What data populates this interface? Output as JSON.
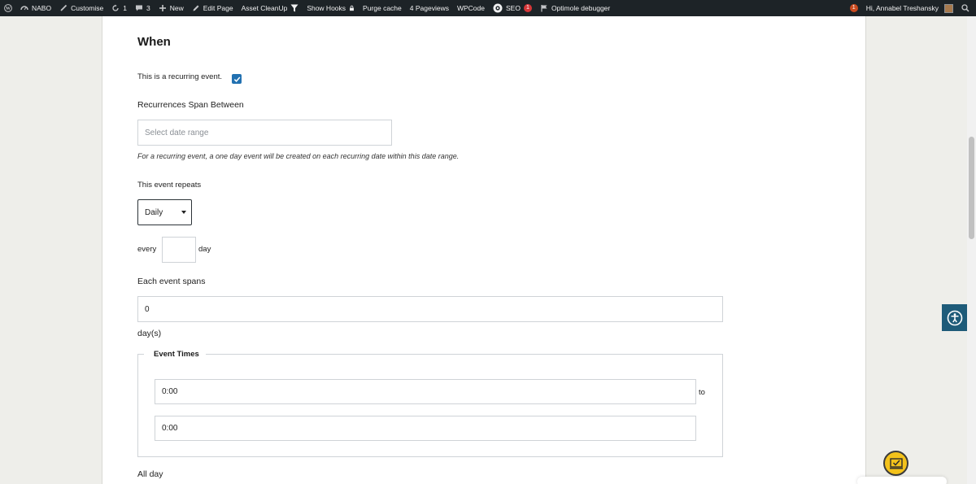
{
  "adminbar": {
    "site_name": "NABO",
    "customise": "Customise",
    "updates_count": "1",
    "comments_count": "3",
    "new": "New",
    "edit_page": "Edit Page",
    "asset_cleanup": "Asset CleanUp",
    "show_hooks": "Show Hooks",
    "purge_cache": "Purge cache",
    "pageviews": "4 Pageviews",
    "wpcode": "WPCode",
    "seo": "SEO",
    "seo_badge": "1",
    "optimole": "Optimole debugger",
    "notif_badge": "1",
    "greeting": "Hi, Annabel Treshansky"
  },
  "form": {
    "heading": "When",
    "recurring_label": "This is a recurring event.",
    "recurring_checked": true,
    "span_label": "Recurrences Span Between",
    "span_placeholder": "Select date range",
    "span_help": "For a recurring event, a one day event will be created on each recurring date within this date range.",
    "repeats_label": "This event repeats",
    "repeats_value": "Daily",
    "every_label": "every",
    "every_value": "",
    "day_label": "day",
    "spans_label": "Each event spans",
    "spans_value": "0",
    "days_unit": "day(s)",
    "event_times_legend": "Event Times",
    "start_time": "0:00",
    "to_label": "to",
    "end_time": "0:00",
    "allday_label": "All day"
  },
  "colors": {
    "adminbar_bg": "#1d2327",
    "checkbox_accent": "#2271b1",
    "a11y_button": "#1e5b79",
    "fab_yellow": "#f3c21b"
  },
  "icons": [
    "wordpress-icon",
    "dashboard-icon",
    "brush-icon",
    "updates-icon",
    "comment-icon",
    "plus-icon",
    "pencil-icon",
    "filter-icon",
    "lock-icon",
    "seo-icon",
    "flag-icon",
    "search-icon",
    "accessibility-icon",
    "check-icon"
  ]
}
